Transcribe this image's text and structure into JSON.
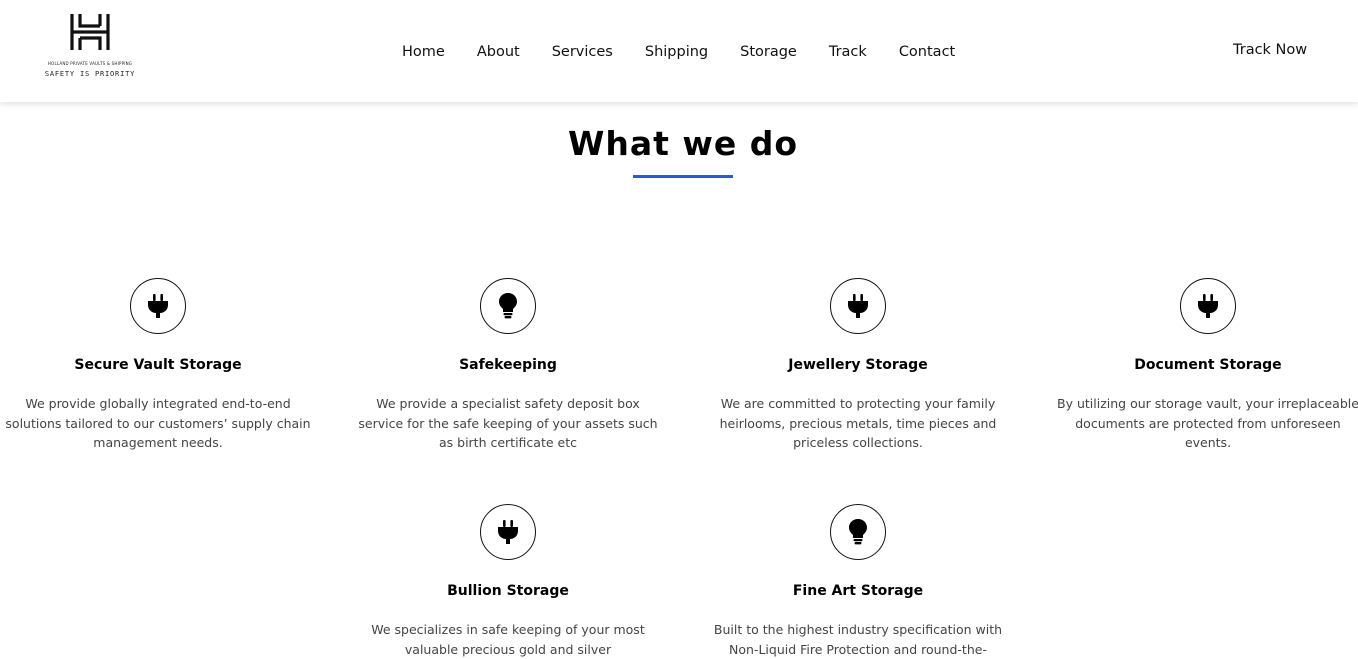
{
  "brand": {
    "small_text": "HOLLAND PRIVATE VAULTS & SHIPPING",
    "tagline": "SAFETY IS PRIORITY"
  },
  "nav": {
    "items": [
      "Home",
      "About",
      "Services",
      "Shipping",
      "Storage",
      "Track",
      "Contact"
    ],
    "cta": "Track Now"
  },
  "section": {
    "title": "What we do",
    "accent_color": "#2a58d6"
  },
  "services": [
    {
      "icon": "plug-icon",
      "title": "Secure Vault Storage",
      "description": "We provide globally integrated end-to-end solutions tailored to our customers’ supply chain management needs."
    },
    {
      "icon": "lightbulb-icon",
      "title": "Safekeeping",
      "description": "We provide a specialist safety deposit box service for the safe keeping of your assets such as birth certificate etc"
    },
    {
      "icon": "plug-icon",
      "title": "Jewellery Storage",
      "description": "We are committed to protecting your family heirlooms, precious metals, time pieces and priceless collections."
    },
    {
      "icon": "plug-icon",
      "title": "Document Storage",
      "description": "By utilizing our storage vault, your irreplaceable documents are protected from unforeseen events."
    },
    {
      "icon": "plug-icon",
      "title": "Bullion Storage",
      "description": "We specializes in safe keeping of your most valuable precious gold and silver"
    },
    {
      "icon": "lightbulb-icon",
      "title": "Fine Art Storage",
      "description": "Built to the highest industry specification with Non-Liquid Fire Protection and round-the-"
    }
  ]
}
